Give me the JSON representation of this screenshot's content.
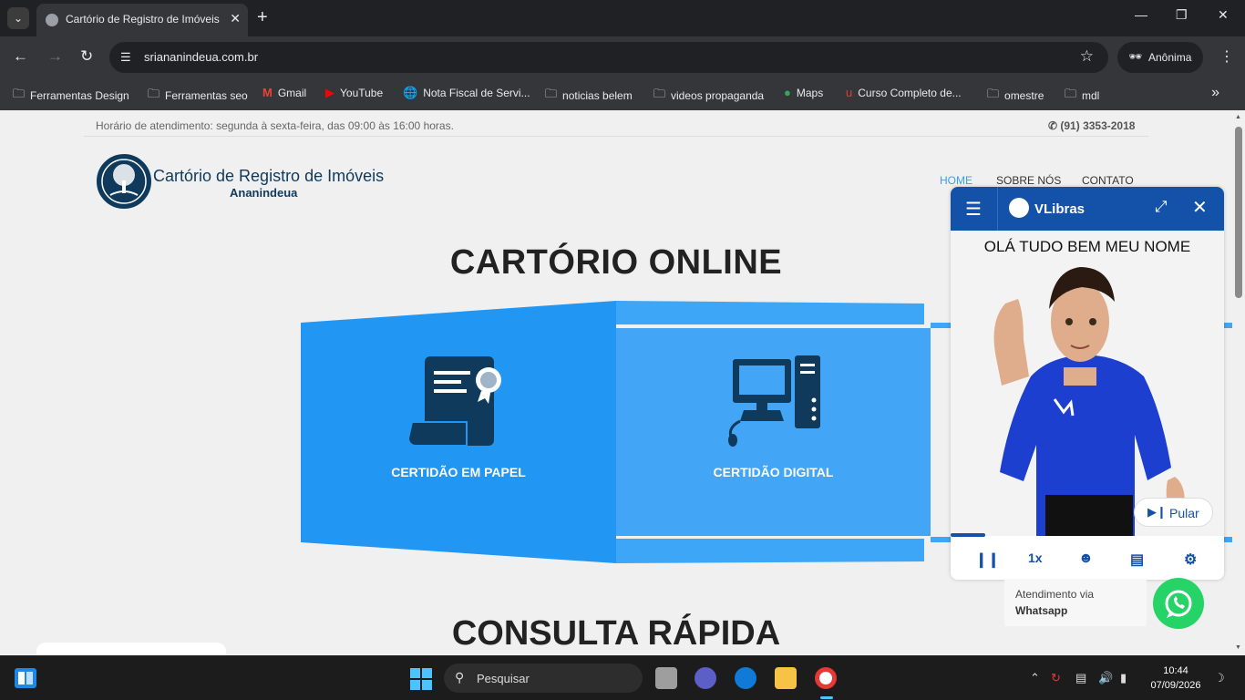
{
  "browser": {
    "tab_title": "Cartório de Registro de Imóveis",
    "url": "sriananindeua.com.br",
    "profile_label": "Anônima",
    "bookmarks": [
      {
        "label": "Ferramentas Design",
        "icon": "folder-icon"
      },
      {
        "label": "Ferramentas seo",
        "icon": "folder-icon"
      },
      {
        "label": "Gmail",
        "icon": "gmail-icon"
      },
      {
        "label": "YouTube",
        "icon": "youtube-icon"
      },
      {
        "label": "Nota Fiscal de Servi...",
        "icon": "globe-icon"
      },
      {
        "label": "noticias belem",
        "icon": "folder-icon"
      },
      {
        "label": "videos propaganda",
        "icon": "folder-icon"
      },
      {
        "label": "Maps",
        "icon": "maps-icon"
      },
      {
        "label": "Curso Completo de...",
        "icon": "udemy-icon"
      },
      {
        "label": "omestre",
        "icon": "folder-icon"
      },
      {
        "label": "mdl",
        "icon": "folder-icon"
      }
    ]
  },
  "site": {
    "hours_text": "Horário de atendimento: segunda à sexta-feira, das 09:00 às 16:00 horas.",
    "phone": "(91) 3353-2018",
    "logo_title": "Cartório de Registro de Imóveis",
    "logo_subtitle": "Ananindeua",
    "menu": [
      "HOME",
      "SOBRE NÓS",
      "CONTATO"
    ],
    "section_title": "CARTÓRIO ONLINE",
    "cards": [
      {
        "label": "CERTIDÃO EM PAPEL",
        "icon": "paper-certificate-icon"
      },
      {
        "label": "CERTIDÃO DIGITAL",
        "icon": "computer-icon"
      }
    ],
    "section2_title": "CONSULTA RÁPIDA",
    "whatsapp_line1": "Atendimento via",
    "whatsapp_line2": "Whatsapp"
  },
  "vlibras": {
    "title": "VLibras",
    "caption": "OLÁ TUDO BEM MEU NOME",
    "skip_label": "Pular",
    "speed_label": "1x"
  },
  "taskbar": {
    "search_placeholder": "Pesquisar",
    "time": "10:44",
    "date": "07/09/2026"
  },
  "colors": {
    "brand_navy": "#0f3a5c",
    "panel_blue": "#2196f3",
    "vlibras_blue": "#1451a8",
    "whatsapp_green": "#25d366"
  }
}
